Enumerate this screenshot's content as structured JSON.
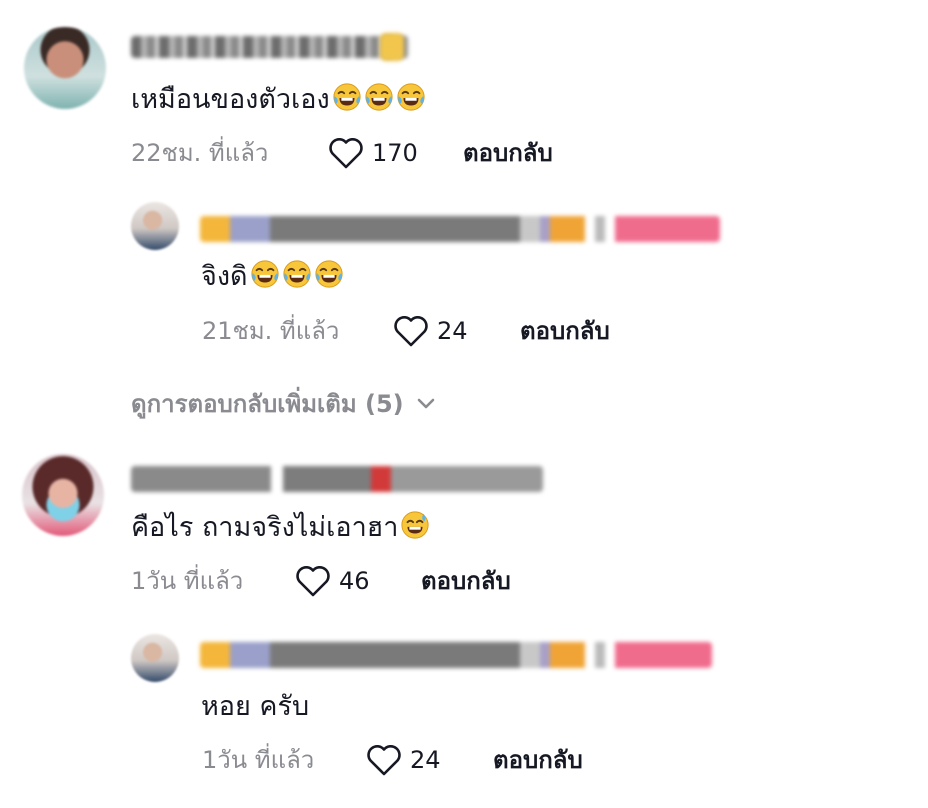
{
  "comments": [
    {
      "text": "เหมือนของตัวเอง",
      "emoji": [
        "laughing-tears",
        "laughing-tears",
        "laughing-tears"
      ],
      "time": "22ชม. ที่แล้ว",
      "likes": "170",
      "reply_label": "ตอบกลับ",
      "replies": [
        {
          "text": "จิงดิ",
          "emoji": [
            "laughing-tears",
            "laughing-tears",
            "laughing-tears"
          ],
          "time": "21ชม. ที่แล้ว",
          "likes": "24",
          "reply_label": "ตอบกลับ"
        }
      ],
      "view_more": "ดูการตอบกลับเพิ่มเติม (5)"
    },
    {
      "text": "คือไร ถามจริงไม่เอาฮา",
      "emoji": [
        "sweat-smile"
      ],
      "time": "1วัน ที่แล้ว",
      "likes": "46",
      "reply_label": "ตอบกลับ",
      "replies": [
        {
          "text": "หอย ครับ",
          "time": "1วัน ที่แล้ว",
          "likes": "24",
          "reply_label": "ตอบกลับ"
        }
      ]
    }
  ],
  "icons": {
    "like": "heart-outline-icon",
    "expand": "chevron-down-icon"
  },
  "colors": {
    "text": "#161823",
    "muted": "#8a8b91",
    "emoji_face": "#f7c63a"
  }
}
